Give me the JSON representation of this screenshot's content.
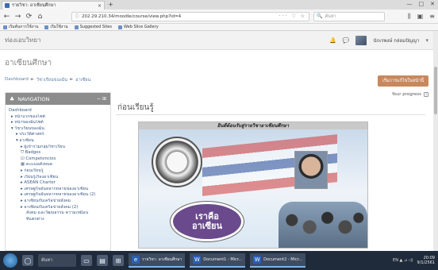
{
  "browser": {
    "tab_title": "รายวิชา: อาเซียนศึกษา",
    "tab_close": "×",
    "tab_new": "+",
    "window_controls": [
      "—",
      "□",
      "✕"
    ],
    "nav": {
      "back": "←",
      "forward": "→",
      "reload": "⟳",
      "home": "⌂"
    },
    "url": "202.29.210.34/moodle/course/view.php?id=4",
    "url_actions": "··· ♡ ☆",
    "search_placeholder": "ค้นหา",
    "toolbar_right": [
      "⫼",
      "▣",
      "≡"
    ],
    "bookmarks": [
      "เริ่มต้นการใช้งาน",
      "เริ่มใช้งาน",
      "Suggested Sites",
      "Web Slice Gallery"
    ]
  },
  "site": {
    "name": "ท่องเอบวิทยา",
    "header_icons": [
      "🔔",
      "💬"
    ],
    "user_name": "นักเรพงษ์ กล่อมปัญญา",
    "user_caret": "▾"
  },
  "course": {
    "title": "อาเซียนศึกษา",
    "breadcrumb": [
      "Dashboard",
      "วิชาเรียนของฉัน",
      "อาเซียน"
    ],
    "breadcrumb_sep": "►",
    "edit_button": "เริ่มการแก้ไขในหน้านี้"
  },
  "navigation": {
    "title": "NAVIGATION",
    "head_icon": "♣",
    "controls": "− ⊞",
    "items": [
      {
        "label": "Dashboard",
        "level": 0
      },
      {
        "label": "▸ หน้าแรกของไซต์",
        "level": 1
      },
      {
        "label": "▸ หน้าของฉันไซต์",
        "level": 1
      },
      {
        "label": "▾ วิชาเรียนของฉัน",
        "level": 1
      },
      {
        "label": "▸ ประวัติศาสตร์",
        "level": 2
      },
      {
        "label": "▾ อาเซียน",
        "level": 2
      },
      {
        "label": "▸ ผู้เข้าร่วมกลุ่มวิชาเรียน",
        "level": 3
      },
      {
        "label": "⛉ Badges",
        "level": 3
      },
      {
        "label": "☑ Competencies",
        "level": 3
      },
      {
        "label": "▦ คะแนนทั้งหมด",
        "level": 3
      },
      {
        "label": "▸ ก่อนเรียนรู้",
        "level": 3
      },
      {
        "label": "▸ เรียนรู้เรื่องอาเซียน",
        "level": 3
      },
      {
        "label": "▸ ASEAN Charter",
        "level": 3
      },
      {
        "label": "▸ เศรษฐกิจอันหลากหลายของอาเซียน",
        "level": 3
      },
      {
        "label": "▸ เศรษฐกิจอันหลากหลายของอาเซียน (2)",
        "level": 3
      },
      {
        "label": "▸ อาเซียนกับเครือข่ายสังคม",
        "level": 3
      },
      {
        "label": "▸ อาเซียนกับเครือข่ายสังคม (2)",
        "level": 3
      },
      {
        "label": "สังคม และวัฒนธรรม ความเหมือน",
        "level": 4
      },
      {
        "label": "ที่แตกต่าง",
        "level": 4
      }
    ]
  },
  "main": {
    "progress_label": "Your progress",
    "progress_help": "?",
    "section_title": "ก่อนเรียนรู้",
    "banner_caption": "ยินดีต้อนรับสู่รายวิชาอาเซียนศึกษา",
    "bubble_line1": "เราคือ",
    "bubble_line2": "อาเซียน"
  },
  "taskbar": {
    "search_text": "ค้นหา",
    "apps": [
      {
        "badge": "e",
        "label": "รายวิชา: อาเซียนศึกษา"
      },
      {
        "badge": "W",
        "label": "Document1 - Micr..."
      },
      {
        "badge": "W",
        "label": "Document2 - Micr..."
      }
    ],
    "tray": "EN ▲ ⊿ ◁)",
    "time": "20:09",
    "date": "9/1/2561"
  }
}
